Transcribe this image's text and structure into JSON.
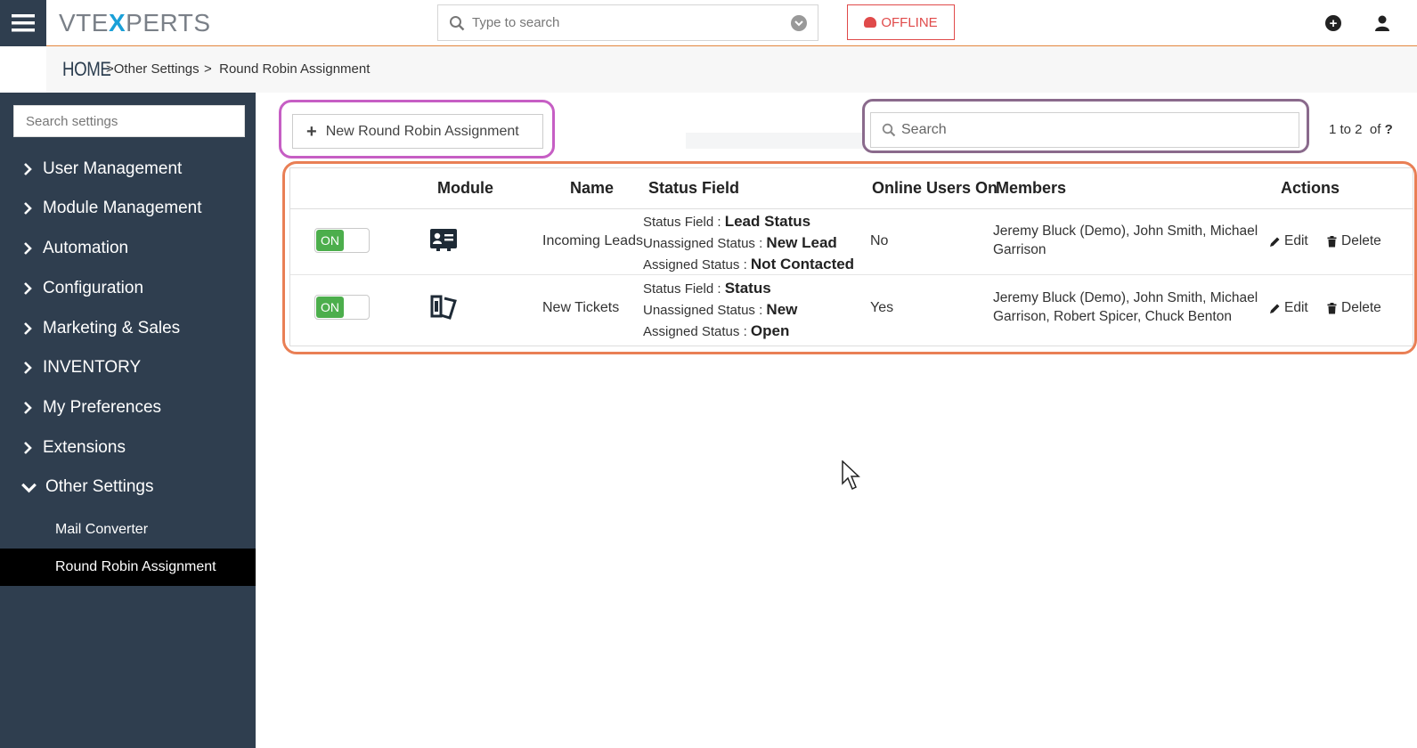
{
  "app": {
    "logo_left": "VTE",
    "logo_x": "X",
    "logo_right": "PERTS"
  },
  "header": {
    "search_placeholder": "Type to search",
    "offline_label": "OFFLINE"
  },
  "breadcrumb": {
    "home": "HOME",
    "sep": ">",
    "level1": "Other Settings",
    "level2": "Round Robin Assignment"
  },
  "sidebar": {
    "search_placeholder": "Search settings",
    "items": [
      {
        "label": "User Management"
      },
      {
        "label": "Module Management"
      },
      {
        "label": "Automation"
      },
      {
        "label": "Configuration"
      },
      {
        "label": "Marketing & Sales"
      },
      {
        "label": "INVENTORY"
      },
      {
        "label": "My Preferences"
      },
      {
        "label": "Extensions"
      },
      {
        "label": "Other Settings"
      }
    ],
    "subitems": [
      {
        "label": "Mail Converter"
      },
      {
        "label": "Round Robin Assignment"
      }
    ]
  },
  "toolbar": {
    "new_label": "New Round Robin Assignment",
    "search_placeholder": "Search",
    "pager_range": "1 to 2",
    "pager_of": "of",
    "pager_total": "?"
  },
  "table": {
    "headers": {
      "module": "Module",
      "name": "Name",
      "status_field": "Status Field",
      "online": "Online Users On",
      "members": "Members",
      "actions": "Actions"
    },
    "status_field_label": "Status Field : ",
    "unassigned_label": "Unassigned Status : ",
    "assigned_label": "Assigned Status : ",
    "edit_label": "Edit",
    "delete_label": "Delete",
    "toggle_label": "ON",
    "rows": [
      {
        "module_icon": "contact-card-icon",
        "name": "Incoming Leads",
        "status_field": "Lead Status",
        "unassigned_status": "New Lead",
        "assigned_status": "Not Contacted",
        "online": "No",
        "members": "Jeremy Bluck (Demo), John Smith, Michael Garrison"
      },
      {
        "module_icon": "tickets-icon",
        "name": "New Tickets",
        "status_field": "Status",
        "unassigned_status": "New",
        "assigned_status": "Open",
        "online": "Yes",
        "members": "Jeremy Bluck (Demo), John Smith, Michael Garrison, Robert Spicer, Chuck Benton"
      }
    ]
  },
  "colors": {
    "sidebar_bg": "#2f3e4f",
    "toggle_on": "#4cae4c",
    "offline_red": "#e04a4a",
    "highlight_pink": "#c65ec4",
    "highlight_gray": "#8a6a8c",
    "highlight_orange": "#e97f55"
  }
}
